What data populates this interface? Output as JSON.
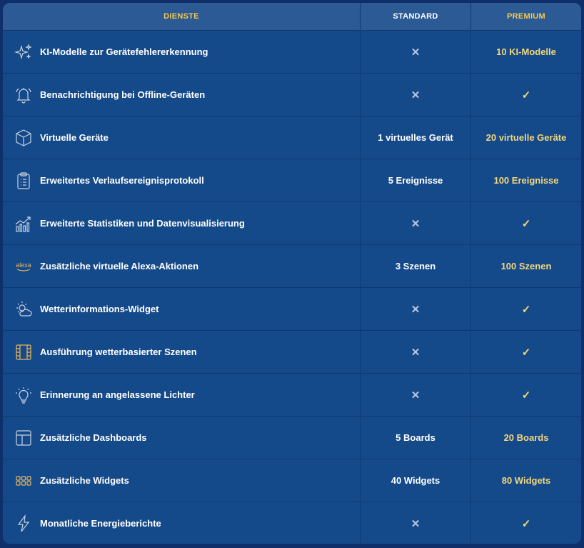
{
  "header": {
    "services": "DIENSTE",
    "standard": "STANDARD",
    "premium": "PREMIUM"
  },
  "colors": {
    "background": "#0e2f6a",
    "table": "#154a8a",
    "header": "#2c5a95",
    "gold": "#f3c94b",
    "premium_text": "#f3d67a",
    "cross": "#b9c7dc"
  },
  "symbols": {
    "cross": "✕",
    "check": "✓"
  },
  "rows": [
    {
      "icon": "sparkles-icon",
      "label": "KI-Modelle zur Gerätefehlererkennung",
      "standard": "✕",
      "premium": "10 KI-Modelle"
    },
    {
      "icon": "bell-icon",
      "label": "Benachrichtigung bei Offline-Geräten",
      "standard": "✕",
      "premium": "✓"
    },
    {
      "icon": "cube-icon",
      "label": "Virtuelle Geräte",
      "standard": "1 virtuelles Gerät",
      "premium": "20 virtuelle Geräte"
    },
    {
      "icon": "clipboard-list-icon",
      "label": "Erweitertes Verlaufsereignisprotokoll",
      "standard": "5 Ereignisse",
      "premium": "100 Ereignisse"
    },
    {
      "icon": "chart-trend-icon",
      "label": "Erweiterte Statistiken und Datenvisualisierung",
      "standard": "✕",
      "premium": "✓"
    },
    {
      "icon": "alexa-logo-icon",
      "label": "Zusätzliche virtuelle Alexa-Aktionen",
      "standard": "3 Szenen",
      "premium": "100 Szenen"
    },
    {
      "icon": "weather-sun-cloud-icon",
      "label": "Wetterinformations-Widget",
      "standard": "✕",
      "premium": "✓"
    },
    {
      "icon": "film-icon",
      "label": "Ausführung wetterbasierter Szenen",
      "standard": "✕",
      "premium": "✓"
    },
    {
      "icon": "lightbulb-icon",
      "label": "Erinnerung an angelassene Lichter",
      "standard": "✕",
      "premium": "✓"
    },
    {
      "icon": "dashboard-layout-icon",
      "label": "Zusätzliche Dashboards",
      "standard": "5 Boards",
      "premium": "20 Boards"
    },
    {
      "icon": "widgets-grid-icon",
      "label": "Zusätzliche Widgets",
      "standard": "40 Widgets",
      "premium": "80 Widgets"
    },
    {
      "icon": "lightning-icon",
      "label": "Monatliche Energieberichte",
      "standard": "✕",
      "premium": "✓"
    }
  ]
}
